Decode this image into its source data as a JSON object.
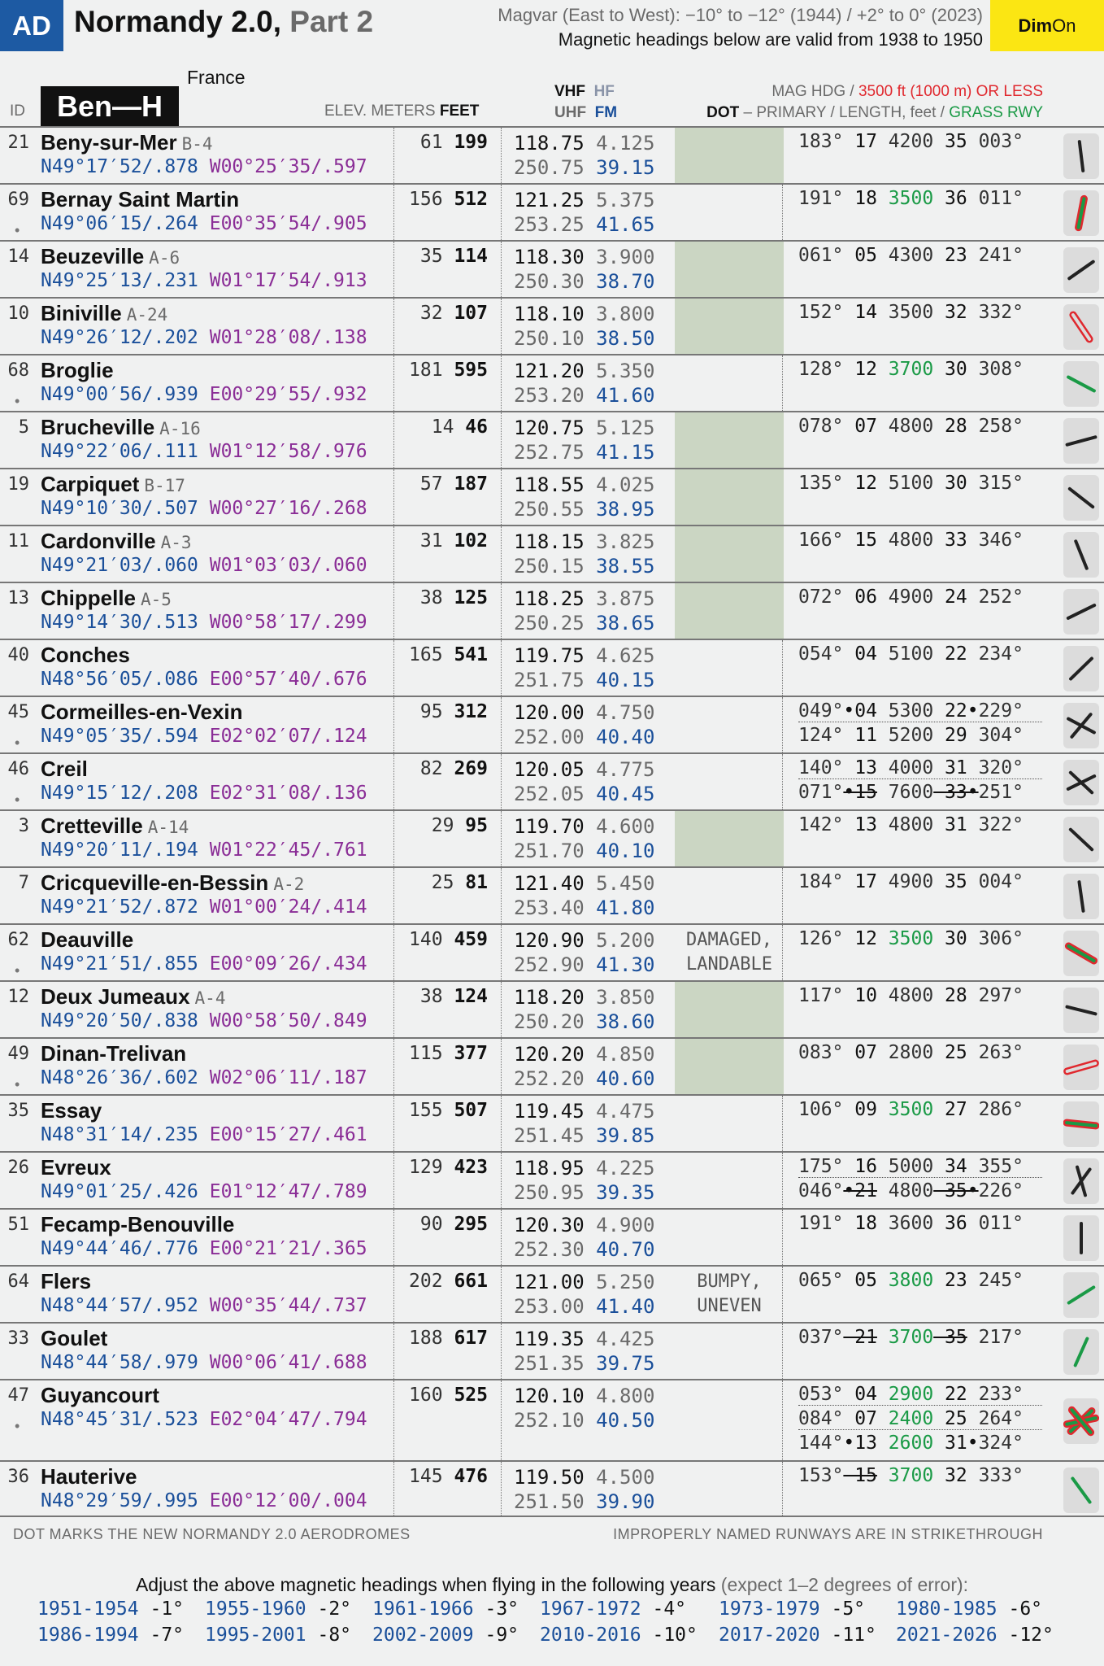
{
  "header": {
    "ad_badge": "AD",
    "title_main": "Normandy 2.0,",
    "title_part": "Part 2",
    "magvar_line1": "Magvar (East to West): −10° to −12° (1944) / +2° to 0° (2023)",
    "magvar_line2": "Magnetic headings below are valid from 1938 to 1950",
    "dim": "Dim",
    "on": "On"
  },
  "table_header": {
    "country": "France",
    "id": "ID",
    "range": "Ben—H",
    "elev_meters": "ELEV. METERS",
    "feet": "FEET",
    "vhf": "VHF",
    "hf": "HF",
    "uhf": "UHF",
    "fm": "FM",
    "mag_hdg": "MAG HDG /",
    "mag_limit": "3500 ft (1000 m) OR LESS",
    "dot": "DOT",
    "primary": " – PRIMARY / LENGTH, feet / ",
    "grass": "GRASS RWY"
  },
  "rows": [
    {
      "id": "21",
      "dot": "",
      "name": "Beny-sur-Mer",
      "code": "B-4",
      "lat": "N49°17′52/.878",
      "lon": "W00°25′35/.597",
      "m": "61",
      "ft": "199",
      "vhf": "118.75",
      "hf": "4.125",
      "uhf": "250.75",
      "fm": "39.15",
      "note": "",
      "green": true
    },
    {
      "id": "69",
      "dot": "•",
      "name": "Bernay Saint Martin",
      "code": "",
      "lat": "N49°06′15/.264",
      "lon": "E00°35′54/.905",
      "m": "156",
      "ft": "512",
      "vhf": "121.25",
      "hf": "5.375",
      "uhf": "253.25",
      "fm": "41.65",
      "note": "",
      "green": false
    },
    {
      "id": "14",
      "dot": "",
      "name": "Beuzeville",
      "code": "A-6",
      "lat": "N49°25′13/.231",
      "lon": "W01°17′54/.913",
      "m": "35",
      "ft": "114",
      "vhf": "118.30",
      "hf": "3.900",
      "uhf": "250.30",
      "fm": "38.70",
      "note": "",
      "green": true
    },
    {
      "id": "10",
      "dot": "",
      "name": "Biniville",
      "code": "A-24",
      "lat": "N49°26′12/.202",
      "lon": "W01°28′08/.138",
      "m": "32",
      "ft": "107",
      "vhf": "118.10",
      "hf": "3.800",
      "uhf": "250.10",
      "fm": "38.50",
      "note": "",
      "green": true
    },
    {
      "id": "68",
      "dot": "•",
      "name": "Broglie",
      "code": "",
      "lat": "N49°00′56/.939",
      "lon": "E00°29′55/.932",
      "m": "181",
      "ft": "595",
      "vhf": "121.20",
      "hf": "5.350",
      "uhf": "253.20",
      "fm": "41.60",
      "note": "",
      "green": false
    },
    {
      "id": "5",
      "dot": "",
      "name": "Brucheville",
      "code": "A-16",
      "lat": "N49°22′06/.111",
      "lon": "W01°12′58/.976",
      "m": "14",
      "ft": "46",
      "vhf": "120.75",
      "hf": "5.125",
      "uhf": "252.75",
      "fm": "41.15",
      "note": "",
      "green": true
    },
    {
      "id": "19",
      "dot": "",
      "name": "Carpiquet",
      "code": "B-17",
      "lat": "N49°10′30/.507",
      "lon": "W00°27′16/.268",
      "m": "57",
      "ft": "187",
      "vhf": "118.55",
      "hf": "4.025",
      "uhf": "250.55",
      "fm": "38.95",
      "note": "",
      "green": true
    },
    {
      "id": "11",
      "dot": "",
      "name": "Cardonville",
      "code": "A-3",
      "lat": "N49°21′03/.060",
      "lon": "W01°03′03/.060",
      "m": "31",
      "ft": "102",
      "vhf": "118.15",
      "hf": "3.825",
      "uhf": "250.15",
      "fm": "38.55",
      "note": "",
      "green": true
    },
    {
      "id": "13",
      "dot": "",
      "name": "Chippelle",
      "code": "A-5",
      "lat": "N49°14′30/.513",
      "lon": "W00°58′17/.299",
      "m": "38",
      "ft": "125",
      "vhf": "118.25",
      "hf": "3.875",
      "uhf": "250.25",
      "fm": "38.65",
      "note": "",
      "green": true
    },
    {
      "id": "40",
      "dot": "",
      "name": "Conches",
      "code": "",
      "lat": "N48°56′05/.086",
      "lon": "E00°57′40/.676",
      "m": "165",
      "ft": "541",
      "vhf": "119.75",
      "hf": "4.625",
      "uhf": "251.75",
      "fm": "40.15",
      "note": "",
      "green": false
    },
    {
      "id": "45",
      "dot": "•",
      "name": "Cormeilles-en-Vexin",
      "code": "",
      "lat": "N49°05′35/.594",
      "lon": "E02°02′07/.124",
      "m": "95",
      "ft": "312",
      "vhf": "120.00",
      "hf": "4.750",
      "uhf": "252.00",
      "fm": "40.40",
      "note": "",
      "green": false
    },
    {
      "id": "46",
      "dot": "•",
      "name": "Creil",
      "code": "",
      "lat": "N49°15′12/.208",
      "lon": "E02°31′08/.136",
      "m": "82",
      "ft": "269",
      "vhf": "120.05",
      "hf": "4.775",
      "uhf": "252.05",
      "fm": "40.45",
      "note": "",
      "green": false
    },
    {
      "id": "3",
      "dot": "",
      "name": "Cretteville",
      "code": "A-14",
      "lat": "N49°20′11/.194",
      "lon": "W01°22′45/.761",
      "m": "29",
      "ft": "95",
      "vhf": "119.70",
      "hf": "4.600",
      "uhf": "251.70",
      "fm": "40.10",
      "note": "",
      "green": true
    },
    {
      "id": "7",
      "dot": "",
      "name": "Cricqueville-en-Bessin",
      "code": "A-2",
      "lat": "N49°21′52/.872",
      "lon": "W01°00′24/.414",
      "m": "25",
      "ft": "81",
      "vhf": "121.40",
      "hf": "5.450",
      "uhf": "253.40",
      "fm": "41.80",
      "note": "",
      "green": false
    },
    {
      "id": "62",
      "dot": "•",
      "name": "Deauville",
      "code": "",
      "lat": "N49°21′51/.855",
      "lon": "E00°09′26/.434",
      "m": "140",
      "ft": "459",
      "vhf": "120.90",
      "hf": "5.200",
      "uhf": "252.90",
      "fm": "41.30",
      "note": "DAMAGED,\nLANDABLE",
      "green": false
    },
    {
      "id": "12",
      "dot": "",
      "name": "Deux Jumeaux",
      "code": "A-4",
      "lat": "N49°20′50/.838",
      "lon": "W00°58′50/.849",
      "m": "38",
      "ft": "124",
      "vhf": "118.20",
      "hf": "3.850",
      "uhf": "250.20",
      "fm": "38.60",
      "note": "",
      "green": true
    },
    {
      "id": "49",
      "dot": "•",
      "name": "Dinan-Trelivan",
      "code": "",
      "lat": "N48°26′36/.602",
      "lon": "W02°06′11/.187",
      "m": "115",
      "ft": "377",
      "vhf": "120.20",
      "hf": "4.850",
      "uhf": "252.20",
      "fm": "40.60",
      "note": "",
      "green": true
    },
    {
      "id": "35",
      "dot": "",
      "name": "Essay",
      "code": "",
      "lat": "N48°31′14/.235",
      "lon": "E00°15′27/.461",
      "m": "155",
      "ft": "507",
      "vhf": "119.45",
      "hf": "4.475",
      "uhf": "251.45",
      "fm": "39.85",
      "note": "",
      "green": false
    },
    {
      "id": "26",
      "dot": "",
      "name": "Evreux",
      "code": "",
      "lat": "N49°01′25/.426",
      "lon": "E01°12′47/.789",
      "m": "129",
      "ft": "423",
      "vhf": "118.95",
      "hf": "4.225",
      "uhf": "250.95",
      "fm": "39.35",
      "note": "",
      "green": false
    },
    {
      "id": "51",
      "dot": "",
      "name": "Fecamp-Benouville",
      "code": "",
      "lat": "N49°44′46/.776",
      "lon": "E00°21′21/.365",
      "m": "90",
      "ft": "295",
      "vhf": "120.30",
      "hf": "4.900",
      "uhf": "252.30",
      "fm": "40.70",
      "note": "",
      "green": false
    },
    {
      "id": "64",
      "dot": "",
      "name": "Flers",
      "code": "",
      "lat": "N48°44′57/.952",
      "lon": "W00°35′44/.737",
      "m": "202",
      "ft": "661",
      "vhf": "121.00",
      "hf": "5.250",
      "uhf": "253.00",
      "fm": "41.40",
      "note": "BUMPY,\nUNEVEN",
      "green": false
    },
    {
      "id": "33",
      "dot": "",
      "name": "Goulet",
      "code": "",
      "lat": "N48°44′58/.979",
      "lon": "W00°06′41/.688",
      "m": "188",
      "ft": "617",
      "vhf": "119.35",
      "hf": "4.425",
      "uhf": "251.35",
      "fm": "39.75",
      "note": "",
      "green": false
    },
    {
      "id": "47",
      "dot": "•",
      "name": "Guyancourt",
      "code": "",
      "lat": "N48°45′31/.523",
      "lon": "E02°04′47/.794",
      "m": "160",
      "ft": "525",
      "vhf": "120.10",
      "hf": "4.800",
      "uhf": "252.10",
      "fm": "40.50",
      "note": "",
      "green": false
    },
    {
      "id": "36",
      "dot": "",
      "name": "Hauterive",
      "code": "",
      "lat": "N48°29′59/.995",
      "lon": "E00°12′00/.004",
      "m": "145",
      "ft": "476",
      "vhf": "119.50",
      "hf": "4.500",
      "uhf": "251.50",
      "fm": "39.90",
      "note": "",
      "green": false
    }
  ],
  "runways": [
    [
      [
        "183°",
        " 17",
        " 4200",
        " 35",
        " 003°"
      ]
    ],
    [
      [
        "191°",
        " 18",
        " 3500",
        " 36",
        " 011°"
      ]
    ],
    [
      [
        "061°",
        " 05",
        " 4300",
        " 23",
        " 241°"
      ]
    ],
    [
      [
        "152°",
        " 14",
        " 3500",
        " 32",
        " 332°"
      ]
    ],
    [
      [
        "128°",
        " 12",
        " 3700",
        " 30",
        " 308°"
      ]
    ],
    [
      [
        "078°",
        " 07",
        " 4800",
        " 28",
        " 258°"
      ]
    ],
    [
      [
        "135°",
        " 12",
        " 5100",
        " 30",
        " 315°"
      ]
    ],
    [
      [
        "166°",
        " 15",
        " 4800",
        " 33",
        " 346°"
      ]
    ],
    [
      [
        "072°",
        " 06",
        " 4900",
        " 24",
        " 252°"
      ]
    ],
    [
      [
        "054°",
        " 04",
        " 5100",
        " 22",
        " 234°"
      ]
    ],
    [
      [
        "049°",
        "•04",
        " 5300",
        " 22•",
        "229°"
      ],
      [
        "124°",
        " 11",
        " 5200",
        " 29",
        " 304°"
      ]
    ],
    [
      [
        "140°",
        " 13",
        " 4000",
        " 31",
        " 320°"
      ],
      [
        "071°",
        "•15",
        " 7600",
        " 33•",
        "251°"
      ]
    ],
    [
      [
        "142°",
        " 13",
        " 4800",
        " 31",
        " 322°"
      ]
    ],
    [
      [
        "184°",
        " 17",
        " 4900",
        " 35",
        " 004°"
      ]
    ],
    [
      [
        "126°",
        " 12",
        " 3500",
        " 30",
        " 306°"
      ]
    ],
    [
      [
        "117°",
        " 10",
        " 4800",
        " 28",
        " 297°"
      ]
    ],
    [
      [
        "083°",
        " 07",
        " 2800",
        " 25",
        " 263°"
      ]
    ],
    [
      [
        "106°",
        " 09",
        " 3500",
        " 27",
        " 286°"
      ]
    ],
    [
      [
        "175°",
        " 16",
        " 5000",
        " 34",
        " 355°"
      ],
      [
        "046°",
        "•21",
        " 4800",
        " 35•",
        "226°"
      ]
    ],
    [
      [
        "191°",
        " 18",
        " 3600",
        " 36",
        " 011°"
      ]
    ],
    [
      [
        "065°",
        " 05",
        " 3800",
        " 23",
        " 245°"
      ]
    ],
    [
      [
        "037°",
        " 21",
        " 3700",
        " 35",
        " 217°"
      ]
    ],
    [
      [
        "053°",
        " 04",
        " 2900",
        " 22",
        " 233°"
      ],
      [
        "084°",
        " 07",
        " 2400",
        " 25",
        " 264°"
      ],
      [
        "144°",
        "•13",
        " 2600",
        " 31•",
        "324°"
      ]
    ],
    [
      [
        "153°",
        " 15",
        " 3700",
        " 32",
        " 333°"
      ]
    ]
  ],
  "footer": {
    "left": "DOT MARKS THE NEW NORMANDY 2.0 AERODROMES",
    "right": "IMPROPERLY NAMED RUNWAYS ARE IN STRIKETHROUGH",
    "adjust_title": "Adjust the above magnetic headings when flying in the following years",
    "adjust_note": " (expect 1–2 degrees of error):",
    "adjustments": [
      {
        "years": "1951-1954",
        "deg": "-1°"
      },
      {
        "years": "1955-1960",
        "deg": "-2°"
      },
      {
        "years": "1961-1966",
        "deg": "-3°"
      },
      {
        "years": "1967-1972",
        "deg": "-4°"
      },
      {
        "years": "1973-1979",
        "deg": "-5°"
      },
      {
        "years": "1980-1985",
        "deg": "-6°"
      },
      {
        "years": "1986-1994",
        "deg": "-7°"
      },
      {
        "years": "1995-2001",
        "deg": "-8°"
      },
      {
        "years": "2002-2009",
        "deg": "-9°"
      },
      {
        "years": "2010-2016",
        "deg": "-10°"
      },
      {
        "years": "2017-2020",
        "deg": "-11°"
      },
      {
        "years": "2021-2026",
        "deg": "-12°"
      }
    ]
  },
  "colors": {
    "ad_blue": "#1d5aa3",
    "dim_yellow": "#fbe613",
    "red_short": "#e0282e",
    "green_grass": "#1a9a46",
    "coord_purple": "#8a2d96",
    "fm_blue": "#1a4f9a",
    "cell_green": "#cbd6c3"
  },
  "runway_styles": [
    [
      [
        "",
        "",
        "",
        "",
        ""
      ]
    ],
    [
      [
        "",
        "r",
        "g",
        "r",
        ""
      ]
    ],
    [
      [
        "",
        "",
        "",
        "",
        ""
      ]
    ],
    [
      [
        "",
        "r",
        "",
        "r",
        ""
      ]
    ],
    [
      [
        "",
        "",
        "g",
        "",
        ""
      ]
    ],
    [
      [
        "",
        "",
        "",
        "",
        ""
      ]
    ],
    [
      [
        "",
        "",
        "",
        "",
        ""
      ]
    ],
    [
      [
        "",
        "",
        "",
        "",
        ""
      ]
    ],
    [
      [
        "",
        "",
        "",
        "",
        ""
      ]
    ],
    [
      [
        "",
        "",
        "",
        "",
        ""
      ]
    ],
    [
      [
        "",
        "",
        "",
        "",
        ""
      ],
      [
        "",
        "",
        "",
        "",
        ""
      ]
    ],
    [
      [
        "",
        "",
        "",
        "",
        ""
      ],
      [
        "",
        "s",
        "",
        "s",
        ""
      ]
    ],
    [
      [
        "",
        "",
        "",
        "",
        ""
      ]
    ],
    [
      [
        "",
        "",
        "",
        "",
        ""
      ]
    ],
    [
      [
        "",
        "r",
        "g",
        "r",
        ""
      ]
    ],
    [
      [
        "",
        "",
        "",
        "",
        ""
      ]
    ],
    [
      [
        "",
        "r",
        "",
        "r",
        ""
      ]
    ],
    [
      [
        "",
        "r",
        "g",
        "r",
        ""
      ]
    ],
    [
      [
        "",
        "",
        "",
        "",
        ""
      ],
      [
        "",
        "s",
        "",
        "s",
        ""
      ]
    ],
    [
      [
        "",
        "",
        "",
        "",
        ""
      ]
    ],
    [
      [
        "",
        "",
        "g",
        "",
        ""
      ]
    ],
    [
      [
        "",
        "s",
        "g",
        "s",
        ""
      ]
    ],
    [
      [
        "",
        "r",
        "g",
        "r",
        ""
      ],
      [
        "",
        "r",
        "g",
        "r",
        ""
      ],
      [
        "",
        "r",
        "g",
        "r",
        ""
      ]
    ],
    [
      [
        "",
        "s",
        "g",
        "",
        ""
      ]
    ]
  ],
  "icons": [
    {
      "name": "runway-diagram-icon",
      "lines": [
        [
          173,
          "dark"
        ]
      ]
    },
    {
      "name": "runway-diagram-icon",
      "lines": [
        [
          191,
          "red-green"
        ]
      ]
    },
    {
      "name": "runway-diagram-icon",
      "lines": [
        [
          55,
          "dark"
        ]
      ]
    },
    {
      "name": "runway-diagram-icon",
      "lines": [
        [
          146,
          "red-outline"
        ]
      ]
    },
    {
      "name": "runway-diagram-icon",
      "lines": [
        [
          118,
          "green"
        ]
      ]
    },
    {
      "name": "runway-diagram-icon",
      "lines": [
        [
          75,
          "dark"
        ]
      ]
    },
    {
      "name": "runway-diagram-icon",
      "lines": [
        [
          128,
          "dark"
        ]
      ]
    },
    {
      "name": "runway-diagram-icon",
      "lines": [
        [
          158,
          "dark"
        ]
      ]
    },
    {
      "name": "runway-diagram-icon",
      "lines": [
        [
          64,
          "dark"
        ]
      ]
    },
    {
      "name": "runway-diagram-icon",
      "lines": [
        [
          46,
          "dark"
        ]
      ]
    },
    {
      "name": "runway-diagram-icon",
      "lines": [
        [
          40,
          "dark"
        ],
        [
          118,
          "dark"
        ]
      ]
    },
    {
      "name": "runway-diagram-icon",
      "lines": [
        [
          133,
          "dark"
        ],
        [
          64,
          "dark"
        ]
      ]
    },
    {
      "name": "runway-diagram-icon",
      "lines": [
        [
          133,
          "dark"
        ]
      ]
    },
    {
      "name": "runway-diagram-icon",
      "lines": [
        [
          172,
          "dark"
        ]
      ]
    },
    {
      "name": "runway-diagram-icon",
      "lines": [
        [
          120,
          "red-green"
        ]
      ]
    },
    {
      "name": "runway-diagram-icon",
      "lines": [
        [
          104,
          "dark"
        ]
      ]
    },
    {
      "name": "runway-diagram-icon",
      "lines": [
        [
          74,
          "red-outline"
        ]
      ]
    },
    {
      "name": "runway-diagram-icon",
      "lines": [
        [
          96,
          "red-green"
        ]
      ]
    },
    {
      "name": "runway-diagram-icon",
      "lines": [
        [
          164,
          "dark"
        ],
        [
          36,
          "dark"
        ]
      ]
    },
    {
      "name": "runway-diagram-icon",
      "lines": [
        [
          180,
          "dark"
        ]
      ]
    },
    {
      "name": "runway-diagram-icon",
      "lines": [
        [
          58,
          "green"
        ]
      ]
    },
    {
      "name": "runway-diagram-icon",
      "lines": [
        [
          24,
          "green"
        ]
      ]
    },
    {
      "name": "runway-diagram-icon",
      "lines": [
        [
          46,
          "red-green"
        ],
        [
          78,
          "red-green"
        ],
        [
          140,
          "red-green"
        ]
      ]
    },
    {
      "name": "runway-diagram-icon",
      "lines": [
        [
          144,
          "green"
        ]
      ]
    }
  ]
}
